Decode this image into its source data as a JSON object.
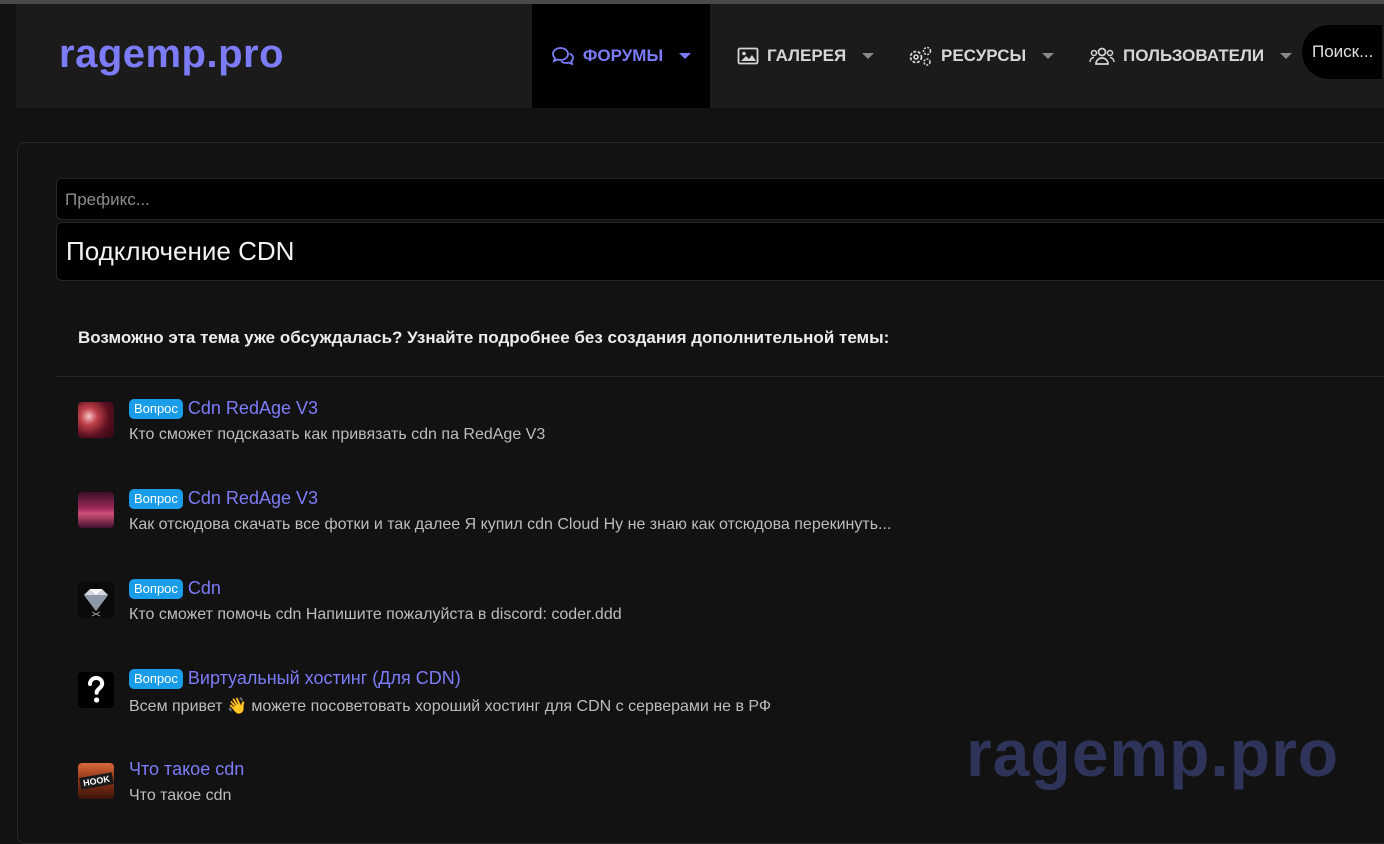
{
  "header": {
    "logo": "ragemp.pro",
    "nav": [
      {
        "label": "ФОРУМЫ",
        "icon": "comments-icon",
        "active": true
      },
      {
        "label": "ГАЛЕРЕЯ",
        "icon": "image-icon",
        "active": false
      },
      {
        "label": "РЕСУРСЫ",
        "icon": "cogs-icon",
        "active": false
      },
      {
        "label": "ПОЛЬЗОВАТЕЛИ",
        "icon": "users-icon",
        "active": false
      }
    ],
    "search_placeholder": "Поиск..."
  },
  "form": {
    "prefix_placeholder": "Префикс...",
    "title_value": "Подключение CDN"
  },
  "similar": {
    "heading": "Возможно эта тема уже обсуждалась? Узнайте подробнее без создания дополнительной темы:",
    "items": [
      {
        "badge": "Вопрос",
        "title": "Cdn RedAge V3",
        "desc": "Кто сможет подсказать как привязать cdn па RedAge V3"
      },
      {
        "badge": "Вопрос",
        "title": "Cdn RedAge V3",
        "desc": "Как отсюдова скачать все фотки и так далее Я купил cdn Cloud Hy не знаю как отсюдова перекинуть..."
      },
      {
        "badge": "Вопрос",
        "title": "Cdn",
        "desc": "Кто сможет помочь cdn Напишите пожалуйста в discord: coder.ddd"
      },
      {
        "badge": "Вопрос",
        "title": "Виртуальный хостинг (Для CDN)",
        "desc": "Всем привет 👋 можете посоветовать хороший хостинг для CDN с серверами не в РФ"
      },
      {
        "badge": "",
        "title": "Что такое cdn",
        "desc": "Что такое cdn",
        "avatar_text": "HOOK"
      }
    ]
  },
  "watermark": "ragemp.pro",
  "colors": {
    "accent": "#7c7cf8",
    "badge": "#199de8",
    "background": "#121212",
    "header": "#1b1b1b"
  }
}
